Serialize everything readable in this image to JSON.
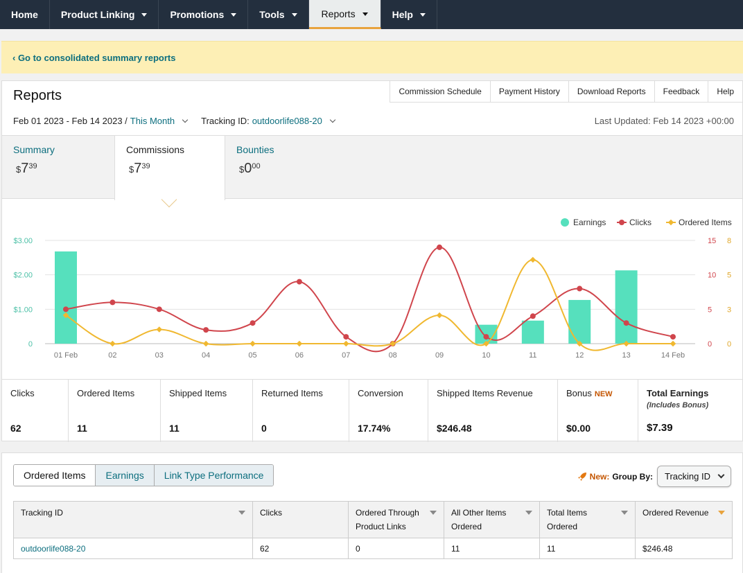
{
  "nav": {
    "items": [
      {
        "label": "Home",
        "dropdown": false,
        "active": false
      },
      {
        "label": "Product Linking",
        "dropdown": true,
        "active": false
      },
      {
        "label": "Promotions",
        "dropdown": true,
        "active": false
      },
      {
        "label": "Tools",
        "dropdown": true,
        "active": false
      },
      {
        "label": "Reports",
        "dropdown": true,
        "active": true
      },
      {
        "label": "Help",
        "dropdown": true,
        "active": false
      }
    ]
  },
  "banner": {
    "link": "‹ Go to consolidated summary reports"
  },
  "reports": {
    "title": "Reports",
    "links": [
      "Commission Schedule",
      "Payment History",
      "Download Reports",
      "Feedback",
      "Help"
    ],
    "date_range": "Feb 01 2023 - Feb 14 2023 /",
    "period": "This Month",
    "tracking_label": "Tracking ID:",
    "tracking_id": "outdoorlife088-20",
    "last_updated": "Last Updated: Feb 14 2023 +00:00"
  },
  "summary_tabs": [
    {
      "label": "Summary",
      "dollar": "$",
      "whole": "7",
      "cents": "39"
    },
    {
      "label": "Commissions",
      "dollar": "$",
      "whole": "7",
      "cents": "39"
    },
    {
      "label": "Bounties",
      "dollar": "$",
      "whole": "0",
      "cents": "00"
    }
  ],
  "chart_data": {
    "type": "bar+line",
    "categories": [
      "01 Feb",
      "02",
      "03",
      "04",
      "05",
      "06",
      "07",
      "08",
      "09",
      "10",
      "11",
      "12",
      "13",
      "14 Feb"
    ],
    "legend": [
      "Earnings",
      "Clicks",
      "Ordered Items"
    ],
    "legend_position": "top-right",
    "series": [
      {
        "name": "Earnings",
        "type": "bar",
        "color": "#56e0bd",
        "axis": "left",
        "values": [
          2.68,
          0,
          0,
          0,
          0,
          0,
          0,
          0,
          0,
          0.55,
          0.67,
          1.27,
          2.13,
          0
        ]
      },
      {
        "name": "Clicks",
        "type": "line",
        "color": "#d0454c",
        "axis": "right1",
        "values": [
          5,
          6,
          5,
          2,
          3,
          9,
          1,
          0,
          14,
          1,
          4,
          8,
          3,
          1
        ]
      },
      {
        "name": "Ordered Items",
        "type": "line",
        "color": "#f0b830",
        "axis": "right2",
        "values": [
          2.2,
          0,
          1.1,
          0,
          0,
          0,
          0,
          0,
          2.2,
          0,
          6.5,
          0,
          0,
          0
        ]
      }
    ],
    "left_axis": {
      "ticks": [
        "0",
        "$1.00",
        "$2.00",
        "$3.00"
      ],
      "max": 3
    },
    "right_axis_1": {
      "ticks": [
        "0",
        "5",
        "10",
        "15"
      ],
      "max": 15
    },
    "right_axis_2": {
      "ticks": [
        "0",
        "3",
        "5",
        "8"
      ],
      "max": 8
    },
    "grid": true
  },
  "metrics": [
    {
      "label": "Clicks",
      "value": "62"
    },
    {
      "label": "Ordered Items",
      "value": "11"
    },
    {
      "label": "Shipped Items",
      "value": "11"
    },
    {
      "label": "Returned Items",
      "value": "0"
    },
    {
      "label": "Conversion",
      "value": "17.74%"
    },
    {
      "label": "Shipped Items Revenue",
      "value": "$246.48"
    },
    {
      "label": "Bonus",
      "new_tag": "NEW",
      "value": "$0.00"
    },
    {
      "label": "Total Earnings",
      "sub": "(Includes Bonus)",
      "value": "$7.39"
    }
  ],
  "bottom": {
    "tabs": [
      "Ordered Items",
      "Earnings",
      "Link Type Performance"
    ],
    "new_label": "New:",
    "group_by_label": "Group By:",
    "group_by_value": "Tracking ID",
    "columns": [
      "Tracking ID",
      "Clicks",
      "Ordered Through Product Links",
      "All Other Items Ordered",
      "Total Items Ordered",
      "Ordered Revenue"
    ],
    "rows": [
      [
        "outdoorlife088-20",
        "62",
        "0",
        "11",
        "11",
        "$246.48"
      ]
    ]
  }
}
